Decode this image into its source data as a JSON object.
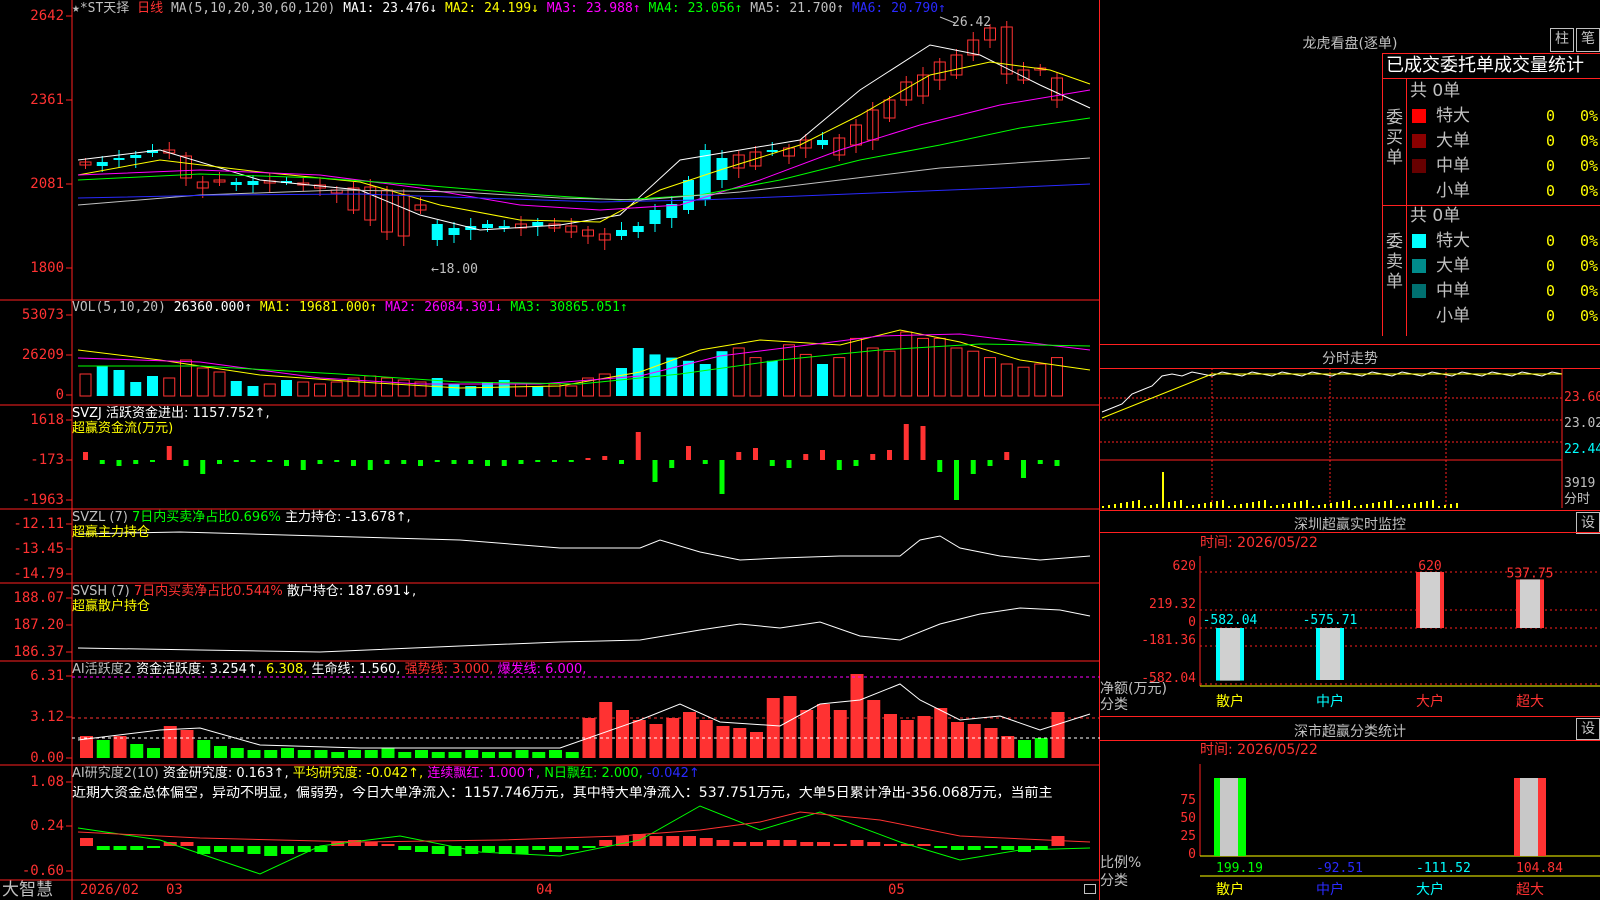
{
  "app": {
    "brand": "大智慧",
    "chart_type": "日线"
  },
  "kline": {
    "stock_name": "★*ST天择",
    "ma_params": "MA(5,10,20,30,60,120)",
    "ma_values": [
      {
        "label": "MA1: 23.476↓",
        "color": "#ffffff"
      },
      {
        "label": "MA2: 24.199↓",
        "color": "#ffff00"
      },
      {
        "label": "MA3: 23.988↑",
        "color": "#ff00ff"
      },
      {
        "label": "MA4: 23.056↑",
        "color": "#00ff00"
      },
      {
        "label": "MA5: 21.700↑",
        "color": "#c0c0c0"
      },
      {
        "label": "MA6: 20.790↑",
        "color": "#2a2aff"
      }
    ],
    "y_ticks": [
      "2642",
      "2361",
      "2081",
      "1800"
    ],
    "high_label": "26.42",
    "low_label": "←18.00",
    "colors": {
      "up": "#ff3232",
      "down": "#00ffff"
    },
    "x_labels": [
      "2026/02",
      "03",
      "04",
      "05"
    ]
  },
  "vol": {
    "params": "VOL(5,10,20)",
    "value": "26360.000↑",
    "ma1": "MA1: 19681.000↑",
    "ma2": "MA2: 26084.301↓",
    "ma3": "MA3: 30865.051↑",
    "y_ticks": [
      "53073",
      "26209",
      "0"
    ]
  },
  "svzj": {
    "title": "SVZJ  活跃资金进出: 1157.752↑,",
    "subtitle": "超赢资金流(万元)",
    "y_ticks": [
      "1618",
      "-173",
      "-1963"
    ]
  },
  "svzl": {
    "title": "SVZL (7)",
    "part2": "7日内买卖净占比0.696%",
    "part3": "主力持仓: -13.678↑,",
    "subtitle": "超赢主力持仓",
    "y_ticks": [
      "-12.11",
      "-13.45",
      "-14.79"
    ]
  },
  "svsh": {
    "title": "SVSH (7)",
    "part2": "7日内买卖净占比0.544%",
    "part3": "散户持仓: 187.691↓,",
    "subtitle": "超赢散户持仓",
    "y_ticks": [
      "188.07",
      "187.20",
      "186.37"
    ]
  },
  "ai1": {
    "title": "AI活跃度2",
    "p1": "资金活跃度: 3.254↑,",
    "p2": "6.308,",
    "p3": "生命线: 1.560,",
    "p4": "强势线: 3.000,",
    "p5": "爆发线: 6.000,",
    "y_ticks": [
      "6.31",
      "3.12",
      "0.00"
    ]
  },
  "ai2": {
    "title": "AI研究度2(10)",
    "p1": "资金研究度: 0.163↑,",
    "p2": "平均研究度: -0.042↑,",
    "p3": "连续飘红: 1.000↑,",
    "p4": "N日飘红: 2.000,",
    "p5": "-0.042↑",
    "commentary": "近期大资金总体偏空，异动不明显，偏弱势，今日大单净流入：1157.746万元，其中特大单净流入：537.751万元，大单5日累计净出-356.068万元，当前主",
    "y_ticks": [
      "1.08",
      "0.24",
      "-0.60"
    ]
  },
  "lhb": {
    "title": "龙虎看盘(逐单)",
    "btn_zhu": "柱",
    "btn_bi": "笔",
    "tabs": "已成交委托单成交量统计",
    "buy_label": "委买单",
    "sell_label": "委卖单",
    "buy_total": "共 0单",
    "sell_total": "共 0单",
    "buy_rows": [
      {
        "name": "特大",
        "v1": "0",
        "v2": "0%",
        "color": "#ff0000"
      },
      {
        "name": "大单",
        "v1": "0",
        "v2": "0%",
        "color": "#8b0000"
      },
      {
        "name": "中单",
        "v1": "0",
        "v2": "0%",
        "color": "#660000"
      },
      {
        "name": "小单",
        "v1": "0",
        "v2": "0%",
        "color": "#000000"
      }
    ],
    "sell_rows": [
      {
        "name": "特大",
        "v1": "0",
        "v2": "0%",
        "color": "#00ffff"
      },
      {
        "name": "大单",
        "v1": "0",
        "v2": "0%",
        "color": "#008b8b"
      },
      {
        "name": "中单",
        "v1": "0",
        "v2": "0%",
        "color": "#007070"
      },
      {
        "name": "小单",
        "v1": "0",
        "v2": "0%",
        "color": "#000000"
      }
    ]
  },
  "fenshi": {
    "title": "分时走势",
    "y_ticks": [
      "23.60",
      "23.02",
      "22.44",
      "3919"
    ],
    "bottom_label": "分时"
  },
  "monitor": {
    "title": "深圳超赢实时监控",
    "settings": "设",
    "time": "时间: 2026/05/22",
    "y_ticks": [
      "620",
      "219.32",
      "0",
      "-181.36",
      "-582.04"
    ],
    "unit": "净额(万元)",
    "cat_label": "分类",
    "categories": [
      "散户",
      "中户",
      "大户",
      "超大"
    ],
    "bar_labels": [
      "-582.04",
      "-575.71",
      "620",
      "537.75"
    ]
  },
  "classify": {
    "title": "深市超赢分类统计",
    "settings": "设",
    "time": "时间: 2026/05/22",
    "y_ticks": [
      "75",
      "50",
      "25",
      "0"
    ],
    "unit": "比例%",
    "cat_label": "分类",
    "categories": [
      "散户",
      "中户",
      "大户",
      "超大"
    ],
    "values": [
      "199.19",
      "-92.51",
      "-111.52",
      "104.84"
    ]
  }
}
